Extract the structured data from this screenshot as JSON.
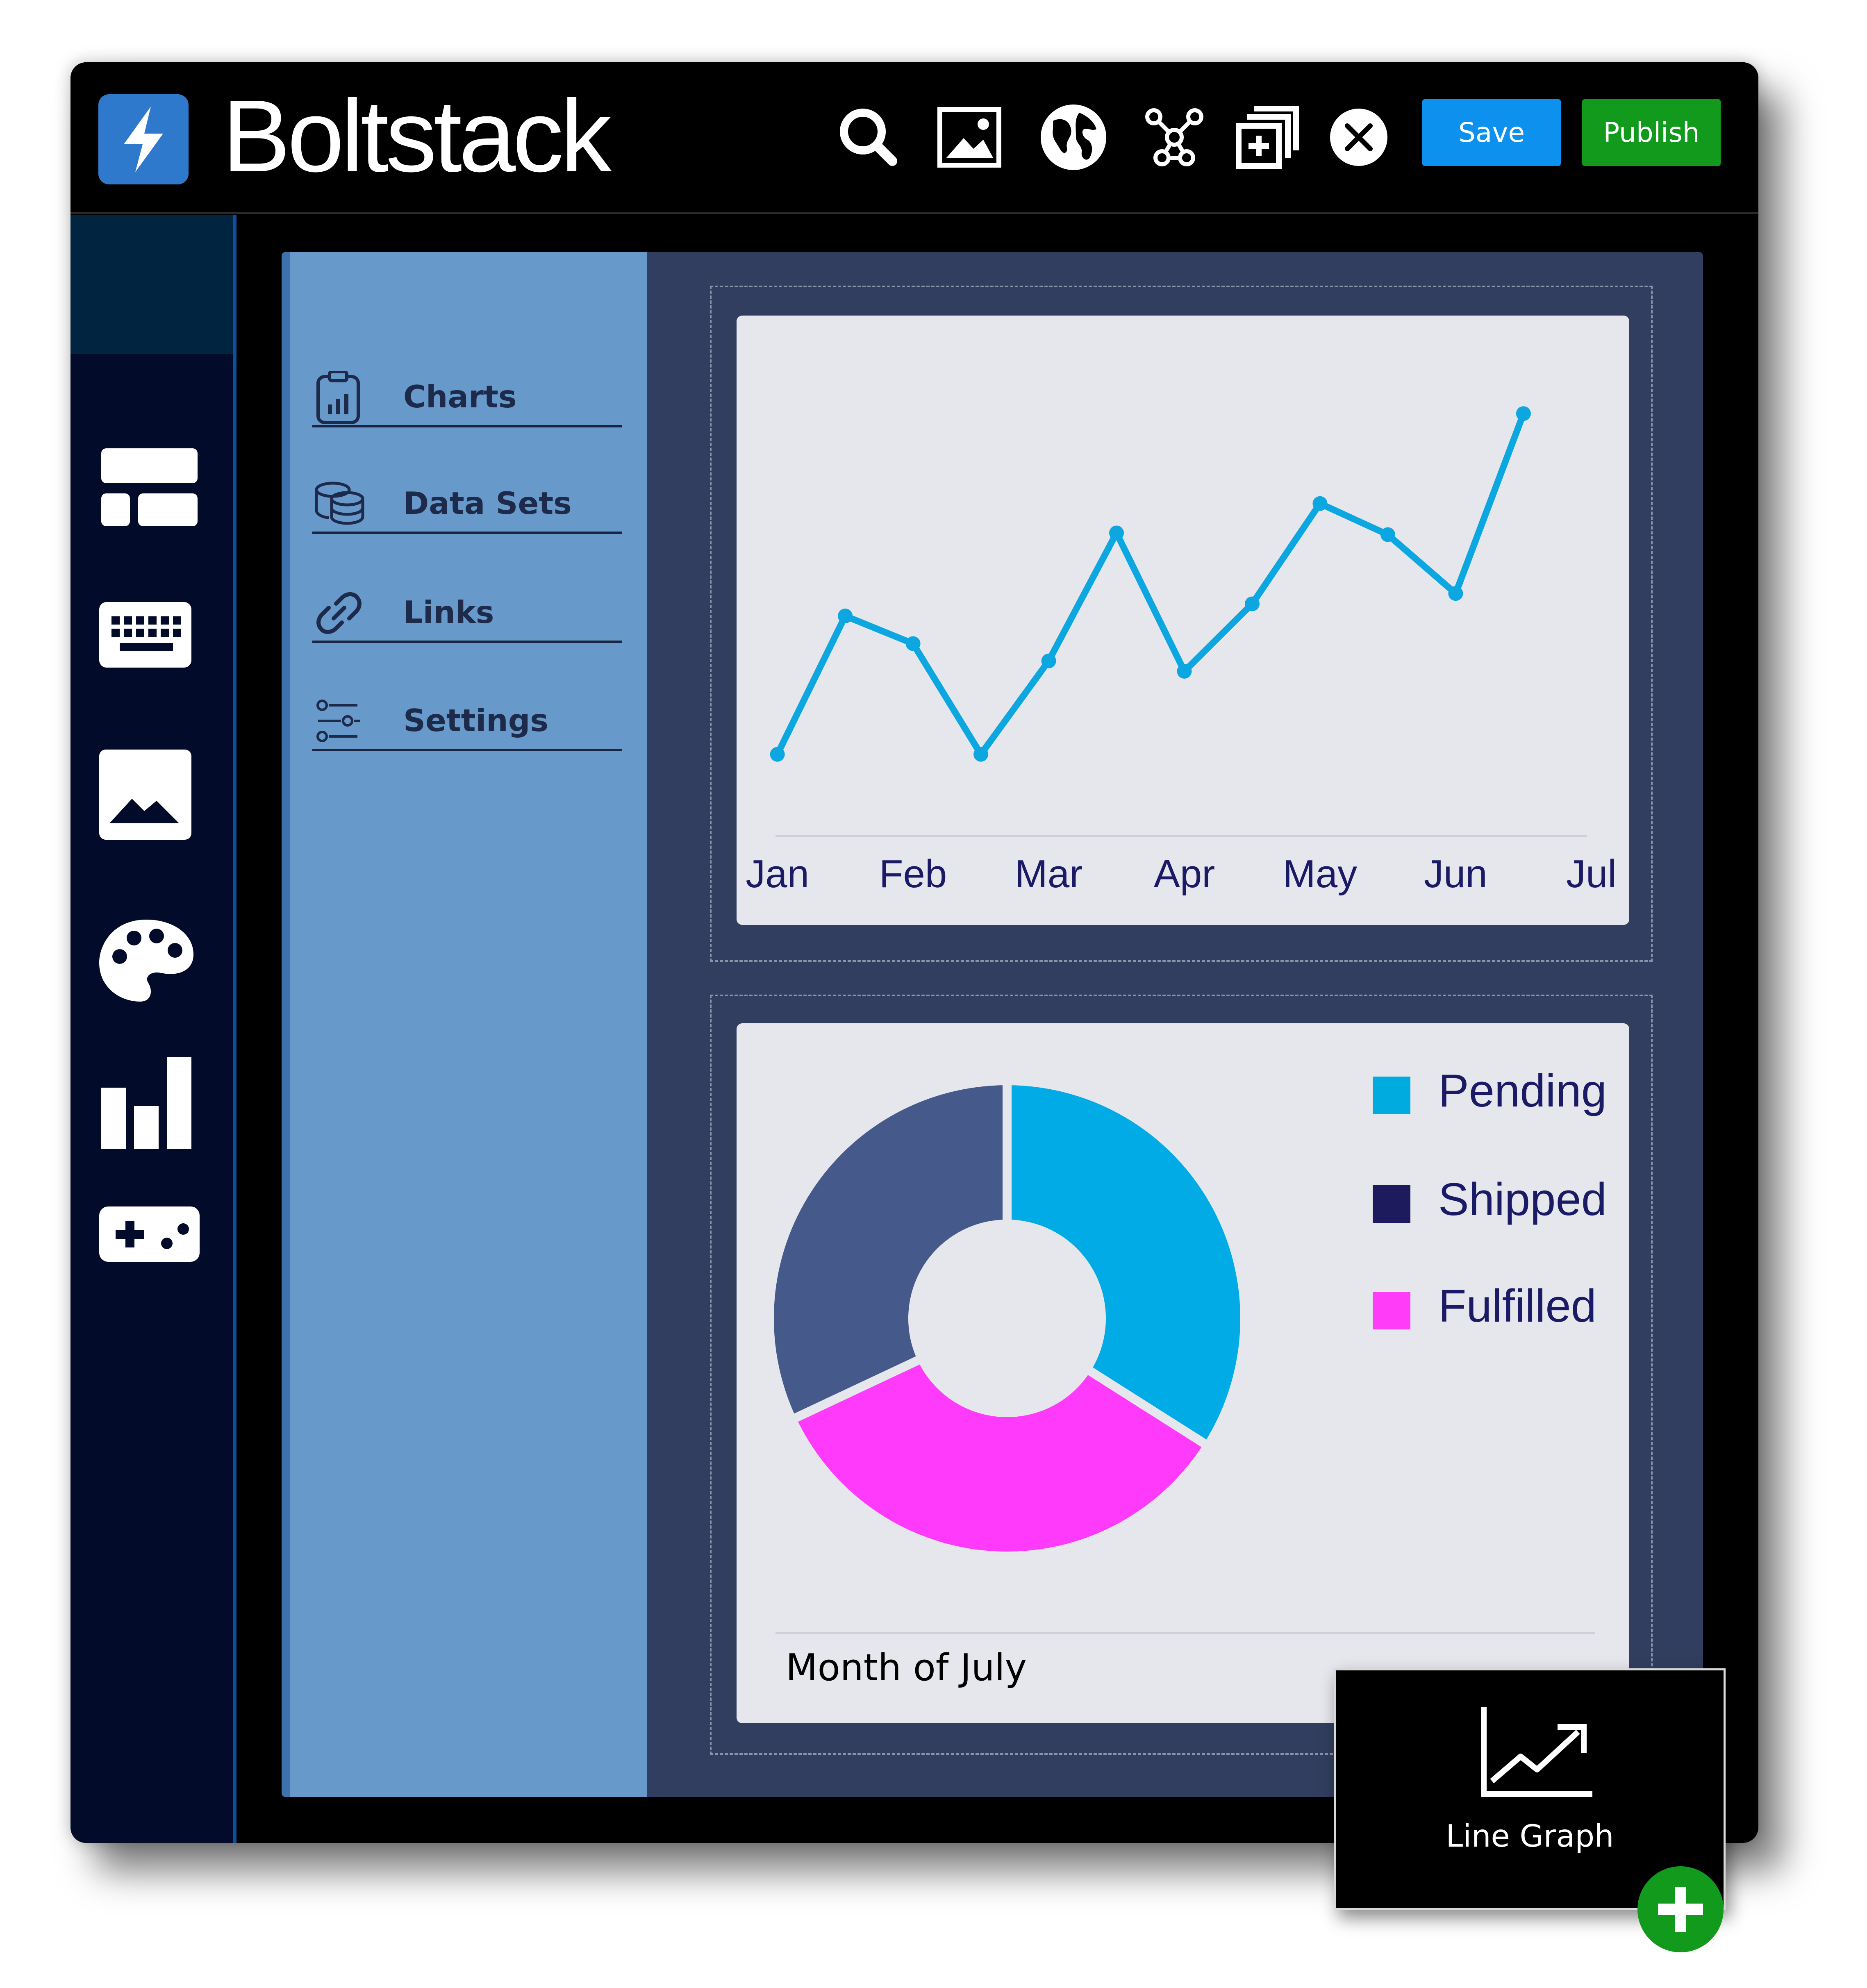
{
  "app": {
    "title": "Boltstack"
  },
  "toolbar": {
    "icons": [
      "search-icon",
      "image-icon",
      "globe-icon",
      "network-icon",
      "duplicate-icon",
      "close-icon"
    ],
    "save_label": "Save",
    "publish_label": "Publish",
    "save_color": "#0c91ee",
    "publish_color": "#129a1d"
  },
  "rail": {
    "icons": [
      "layout-icon",
      "keyboard-icon",
      "image-icon",
      "palette-icon",
      "bar-chart-icon",
      "gamepad-icon"
    ]
  },
  "nav": {
    "items": [
      {
        "label": "Charts",
        "icon": "clipboard-chart-icon"
      },
      {
        "label": "Data Sets",
        "icon": "database-icon"
      },
      {
        "label": "Links",
        "icon": "link-icon"
      },
      {
        "label": "Settings",
        "icon": "sliders-icon"
      }
    ]
  },
  "chart_data": [
    {
      "type": "line",
      "categories": [
        "Jan",
        "Feb",
        "Mar",
        "Apr",
        "May",
        "Jun",
        "Jul"
      ],
      "series": [
        {
          "color": "#0ca7e1",
          "points": [
            {
              "x": 0.0,
              "y": 0.2
            },
            {
              "x": 0.5,
              "y": 1.0
            },
            {
              "x": 1.0,
              "y": 0.84
            },
            {
              "x": 1.5,
              "y": 0.2
            },
            {
              "x": 2.0,
              "y": 0.74
            },
            {
              "x": 2.5,
              "y": 1.48
            },
            {
              "x": 3.0,
              "y": 0.68
            },
            {
              "x": 3.5,
              "y": 1.07
            },
            {
              "x": 4.0,
              "y": 1.65
            },
            {
              "x": 4.5,
              "y": 1.47
            },
            {
              "x": 5.0,
              "y": 1.13
            },
            {
              "x": 5.5,
              "y": 2.17
            }
          ]
        }
      ],
      "xlim": [
        -0.15,
        6.15
      ],
      "ylim": [
        0.0,
        2.5
      ],
      "grid": false
    },
    {
      "type": "pie",
      "donut": true,
      "title": "Month of July",
      "slices": [
        {
          "label": "Pending",
          "value": 34,
          "color": "#01abe5"
        },
        {
          "label": "Shipped",
          "value": 32,
          "color": "#455a8a"
        },
        {
          "label": "Fulfilled",
          "value": 34,
          "color": "#ff3afb"
        }
      ],
      "slice_order": [
        "Pending",
        "Fulfilled",
        "Shipped"
      ],
      "legend": [
        {
          "label": "Pending",
          "color": "#00acdf"
        },
        {
          "label": "Shipped",
          "color": "#1d1a5e"
        },
        {
          "label": "Fulfilled",
          "color": "#ff3cf7"
        }
      ],
      "legend_position": "top-right"
    }
  ],
  "widget": {
    "label": "Line Graph",
    "icon": "line-graph-icon",
    "add_icon": "plus-icon"
  }
}
